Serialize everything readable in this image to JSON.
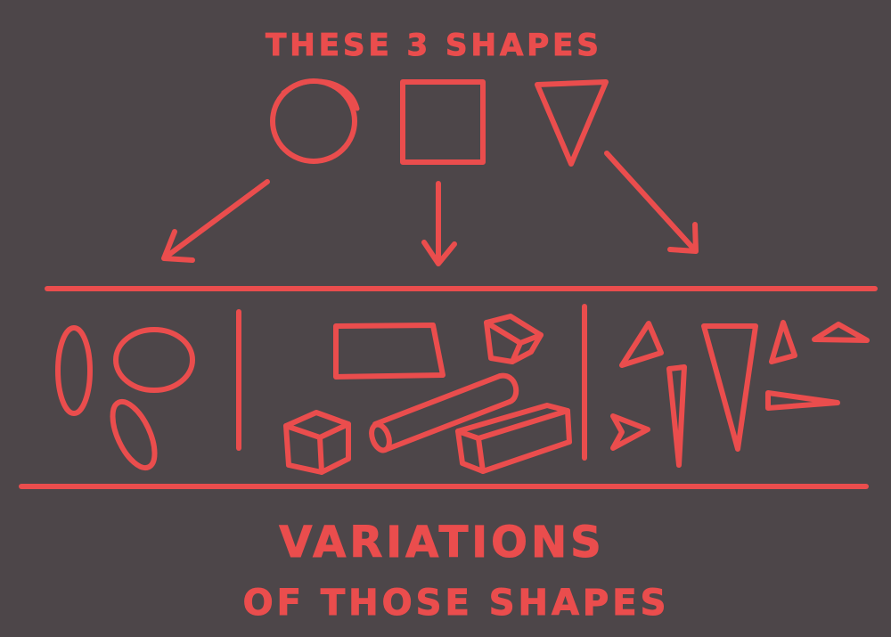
{
  "colors": {
    "background": "#4d4649",
    "ink": "#ea4d4d"
  },
  "top": {
    "title": "THESE 3 SHAPES",
    "shapes": [
      "circle",
      "square",
      "triangle"
    ]
  },
  "bottom": {
    "line1": "VARIATIONS",
    "line2": "OF THOSE SHAPES"
  },
  "variation_groups": [
    {
      "base": "circle",
      "variants": [
        "tall-ellipse",
        "wide-ellipse",
        "tilted-capsule"
      ]
    },
    {
      "base": "square",
      "variants": [
        "rectangle",
        "small-cube",
        "cube",
        "long-cylinder",
        "long-box"
      ]
    },
    {
      "base": "triangle",
      "variants": [
        "small-triangle",
        "tall-spike",
        "long-inverted-triangle",
        "small-upright-triangle",
        "flat-triangle",
        "side-pointing-triangle",
        "tiny-side-triangle"
      ]
    }
  ]
}
